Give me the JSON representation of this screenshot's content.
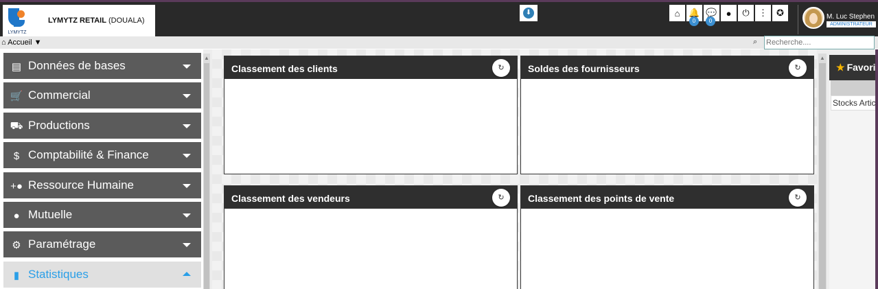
{
  "header": {
    "company_name": "LYMYTZ RETAIL",
    "company_location": " (DOUALA)",
    "logo_text": "LYMYTZ",
    "update_icon": "download-circle-icon",
    "toolbar_icons": [
      "home-icon",
      "bell-icon",
      "chat-icon",
      "user-icon",
      "power-icon",
      "more-vertical-icon",
      "settings-icon"
    ],
    "notifications_count": "0",
    "messages_count": "0",
    "user_name": "M. Luc Stephen",
    "user_role": "ADMINISTRATEUR"
  },
  "breadcrumb": {
    "label": "Accueil"
  },
  "search": {
    "placeholder": "Recherche...."
  },
  "sidebar": {
    "items": [
      {
        "label": "Données de bases",
        "icon": "store-icon"
      },
      {
        "label": "Commercial",
        "icon": "cart-icon"
      },
      {
        "label": "Productions",
        "icon": "truck-icon"
      },
      {
        "label": "Comptabilité & Finance",
        "icon": "dollar-icon"
      },
      {
        "label": "Ressource Humaine",
        "icon": "group-add-icon"
      },
      {
        "label": "Mutuelle",
        "icon": "person-icon"
      },
      {
        "label": "Paramétrage",
        "icon": "gear-icon"
      },
      {
        "label": "Statistiques",
        "icon": "bar-chart-icon"
      }
    ]
  },
  "main": {
    "panels": [
      {
        "title": "Classement des clients"
      },
      {
        "title": "Soldes des fournisseurs"
      },
      {
        "title": "Classement des vendeurs"
      },
      {
        "title": "Classement des points de vente"
      }
    ]
  },
  "favorites": {
    "title": "Favoris",
    "items": [
      "Stocks Articles"
    ]
  },
  "colors": {
    "topbar": "#292929",
    "sidebar_item": "#5b5b5b",
    "active_accent": "#2a9fe8",
    "badge": "#3b8fd0"
  }
}
